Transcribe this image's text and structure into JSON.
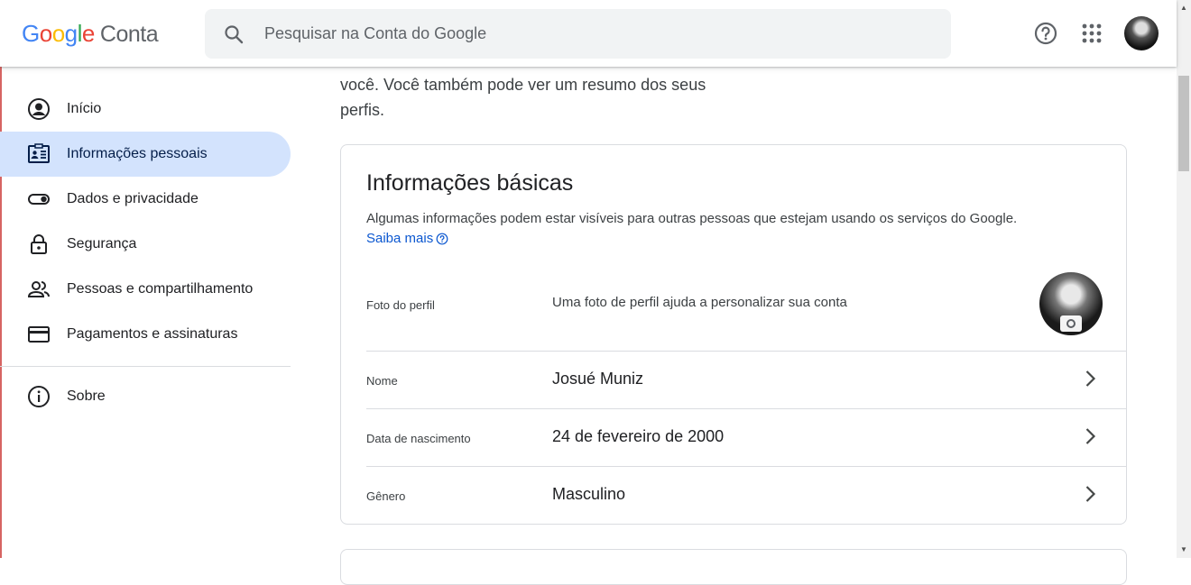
{
  "header": {
    "logo_letters": [
      "G",
      "o",
      "o",
      "g",
      "l",
      "e"
    ],
    "product": "Conta",
    "search_placeholder": "Pesquisar na Conta do Google"
  },
  "sidebar": {
    "items": [
      {
        "label": "Início",
        "icon": "account-circle-icon"
      },
      {
        "label": "Informações pessoais",
        "icon": "id-card-icon",
        "active": true
      },
      {
        "label": "Dados e privacidade",
        "icon": "toggle-icon"
      },
      {
        "label": "Segurança",
        "icon": "lock-icon"
      },
      {
        "label": "Pessoas e compartilhamento",
        "icon": "people-icon"
      },
      {
        "label": "Pagamentos e assinaturas",
        "icon": "credit-card-icon"
      }
    ],
    "about": {
      "label": "Sobre",
      "icon": "info-icon"
    }
  },
  "main": {
    "intro_lines": [
      "você. Você também pode ver um resumo dos seus",
      "perfis."
    ],
    "card": {
      "title": "Informações básicas",
      "description": "Algumas informações podem estar visíveis para outras pessoas que estejam usando os serviços do Google.",
      "learn_more": "Saiba mais",
      "photo": {
        "label": "Foto do perfil",
        "description": "Uma foto de perfil ajuda a personalizar sua conta"
      },
      "rows": [
        {
          "label": "Nome",
          "value": "Josué Muniz"
        },
        {
          "label": "Data de nascimento",
          "value": "24 de fevereiro de 2000"
        },
        {
          "label": "Gênero",
          "value": "Masculino"
        }
      ]
    }
  },
  "colors": {
    "accent": "#0b57d0",
    "active_bg": "#d3e3fd",
    "border": "#dadce0"
  }
}
